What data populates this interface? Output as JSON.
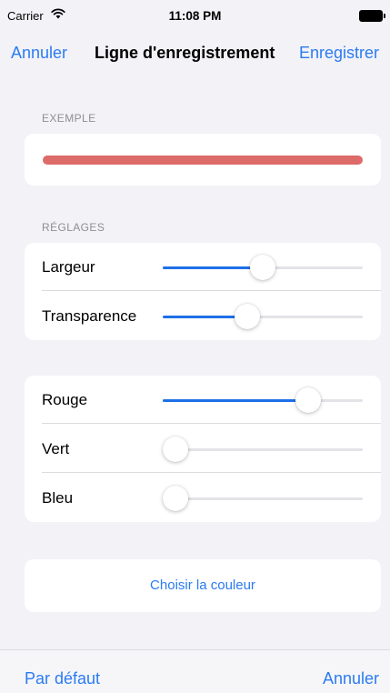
{
  "status_bar": {
    "carrier": "Carrier",
    "time": "11:08 PM",
    "wifi_icon": "wifi-icon",
    "battery_icon": "battery-icon"
  },
  "nav": {
    "cancel_label": "Annuler",
    "title": "Ligne d'enregistrement",
    "save_label": "Enregistrer"
  },
  "sample": {
    "header": "EXEMPLE",
    "line_color": "#dc6b69"
  },
  "settings": {
    "header": "RÉGLAGES",
    "rows": [
      {
        "label": "Largeur",
        "value": 0.5
      },
      {
        "label": "Transparence",
        "value": 0.41
      }
    ]
  },
  "color": {
    "rows": [
      {
        "label": "Rouge",
        "value": 0.76
      },
      {
        "label": "Vert",
        "value": 0.0
      },
      {
        "label": "Bleu",
        "value": 0.0
      }
    ]
  },
  "pick_color_label": "Choisir la couleur",
  "toolbar": {
    "default_label": "Par défaut",
    "cancel_label": "Annuler"
  },
  "colors": {
    "accent": "#2b7bf2",
    "slider_fill": "#1e6fe8",
    "background": "#f2f2f7"
  }
}
